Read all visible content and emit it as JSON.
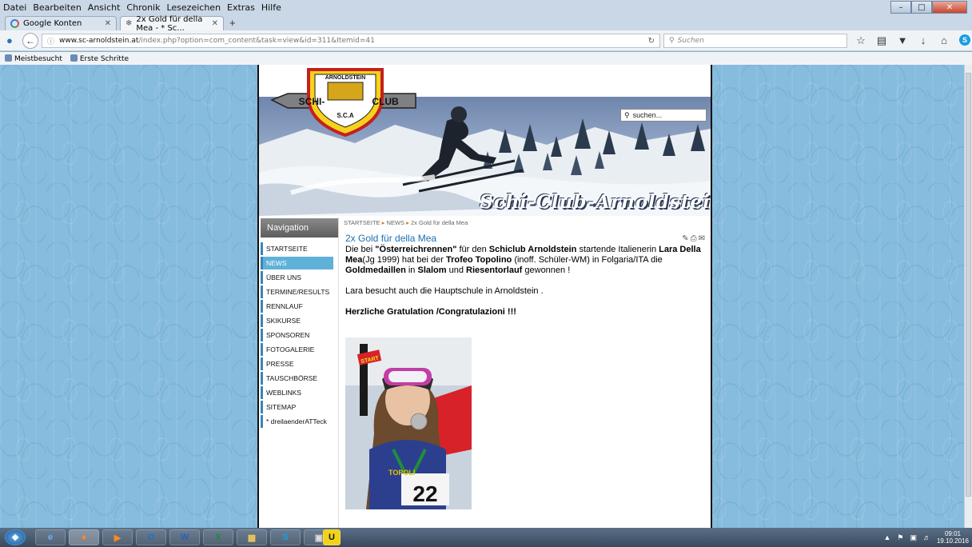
{
  "browser": {
    "menu": [
      "Datei",
      "Bearbeiten",
      "Ansicht",
      "Chronik",
      "Lesezeichen",
      "Extras",
      "Hilfe"
    ],
    "tabs": [
      {
        "label": "Google Konten"
      },
      {
        "label": "2x Gold für della Mea - * Sc..."
      }
    ],
    "new_tab": "+",
    "url_host": "www.sc-arnoldstein.at",
    "url_path": "/index.php?option=com_content&task=view&id=311&Itemid=41",
    "search_placeholder": "Suchen",
    "bookmarks": [
      "Meistbesucht",
      "Erste Schritte"
    ]
  },
  "site": {
    "search_placeholder": "suchen...",
    "title": "Schi-Club-Arnoldstein",
    "logo": {
      "top": "ARNOLDSTEIN",
      "left": "SCHI-",
      "right": "CLUB",
      "bottom": "S.C.A"
    },
    "nav_title": "Navigation",
    "nav_items": [
      "STARTSEITE",
      "NEWS",
      "ÜBER UNS",
      "TERMINE/RESULTS",
      "RENNLAUF",
      "SKIKURSE",
      "SPONSOREN",
      "FOTOGALERIE",
      "PRESSE",
      "TAUSCHBÖRSE",
      "WEBLINKS",
      "SITEMAP",
      "* dreilaenderATTeck"
    ],
    "active_nav": "NEWS",
    "breadcrumb": [
      "STARTSEITE",
      "NEWS",
      "2x Gold für della Mea"
    ],
    "article": {
      "title": "2x Gold für della Mea",
      "p1": [
        {
          "t": "Die bei ",
          "b": false
        },
        {
          "t": "\"Österreichrennen\"",
          "b": true
        },
        {
          "t": " für den ",
          "b": false
        },
        {
          "t": "Schiclub Arnoldstein",
          "b": true
        },
        {
          "t": " startende Italienerin ",
          "b": false
        },
        {
          "t": "Lara Della Mea",
          "b": true
        },
        {
          "t": "(Jg 1999) hat bei der ",
          "b": false
        },
        {
          "t": "Trofeo Topolino",
          "b": true
        },
        {
          "t": " (inoff. Schüler-WM) in Folgaria/ITA die ",
          "b": false
        },
        {
          "t": "Goldmedaillen",
          "b": true
        },
        {
          "t": " in ",
          "b": false
        },
        {
          "t": "Slalom",
          "b": true
        },
        {
          "t": " und ",
          "b": false
        },
        {
          "t": "Riesentorlauf",
          "b": true
        },
        {
          "t": " gewonnen !",
          "b": false
        }
      ],
      "p2": "Lara besucht auch die Hauptschule in Arnoldstein .",
      "p3": "Herzliche Gratulation /Congratulazioni !!!",
      "photo_text": {
        "start": "START",
        "bib": "22",
        "trophy": "TOPOLI"
      }
    }
  },
  "taskbar": {
    "time": "09:01",
    "date": "19.10.2016",
    "apps": [
      "start",
      "ie",
      "firefox",
      "media-player",
      "outlook",
      "word",
      "excel",
      "explorer",
      "skype",
      "photo-editor",
      "u-app"
    ]
  }
}
